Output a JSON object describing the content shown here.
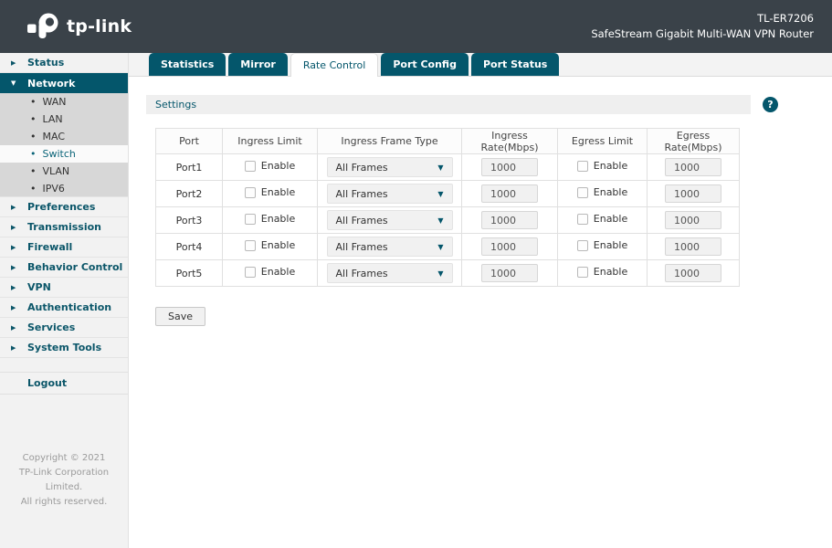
{
  "header": {
    "brand": "tp-link",
    "model": "TL-ER7206",
    "subtitle": "SafeStream Gigabit Multi-WAN VPN Router"
  },
  "sidebar": {
    "items": [
      {
        "label": "Status"
      },
      {
        "label": "Network"
      },
      {
        "label": "WAN"
      },
      {
        "label": "LAN"
      },
      {
        "label": "MAC"
      },
      {
        "label": "Switch"
      },
      {
        "label": "VLAN"
      },
      {
        "label": "IPV6"
      },
      {
        "label": "Preferences"
      },
      {
        "label": "Transmission"
      },
      {
        "label": "Firewall"
      },
      {
        "label": "Behavior Control"
      },
      {
        "label": "VPN"
      },
      {
        "label": "Authentication"
      },
      {
        "label": "Services"
      },
      {
        "label": "System Tools"
      }
    ],
    "logout_label": "Logout",
    "copyright_line1": "Copyright © 2021",
    "copyright_line2": "TP-Link Corporation Limited.",
    "copyright_line3": "All rights reserved."
  },
  "tabs": [
    {
      "label": "Statistics"
    },
    {
      "label": "Mirror"
    },
    {
      "label": "Rate Control",
      "active": true
    },
    {
      "label": "Port Config"
    },
    {
      "label": "Port Status"
    }
  ],
  "settings": {
    "title": "Settings",
    "help_icon": "?"
  },
  "table": {
    "headers": [
      "Port",
      "Ingress Limit",
      "Ingress Frame Type",
      "Ingress Rate(Mbps)",
      "Egress Limit",
      "Egress Rate(Mbps)"
    ],
    "enable_label": "Enable",
    "rows": [
      {
        "port": "Port1",
        "ingress_enabled": false,
        "frame_type": "All Frames",
        "ingress_rate": "1000",
        "egress_enabled": false,
        "egress_rate": "1000"
      },
      {
        "port": "Port2",
        "ingress_enabled": false,
        "frame_type": "All Frames",
        "ingress_rate": "1000",
        "egress_enabled": false,
        "egress_rate": "1000"
      },
      {
        "port": "Port3",
        "ingress_enabled": false,
        "frame_type": "All Frames",
        "ingress_rate": "1000",
        "egress_enabled": false,
        "egress_rate": "1000"
      },
      {
        "port": "Port4",
        "ingress_enabled": false,
        "frame_type": "All Frames",
        "ingress_rate": "1000",
        "egress_enabled": false,
        "egress_rate": "1000"
      },
      {
        "port": "Port5",
        "ingress_enabled": false,
        "frame_type": "All Frames",
        "ingress_rate": "1000",
        "egress_enabled": false,
        "egress_rate": "1000"
      }
    ]
  },
  "actions": {
    "save_label": "Save"
  },
  "colors": {
    "accent": "#04566B",
    "header_bg": "#3A4249",
    "submenu_bg": "#D7D7D7",
    "sidebar_bg": "#F2F2F2"
  }
}
